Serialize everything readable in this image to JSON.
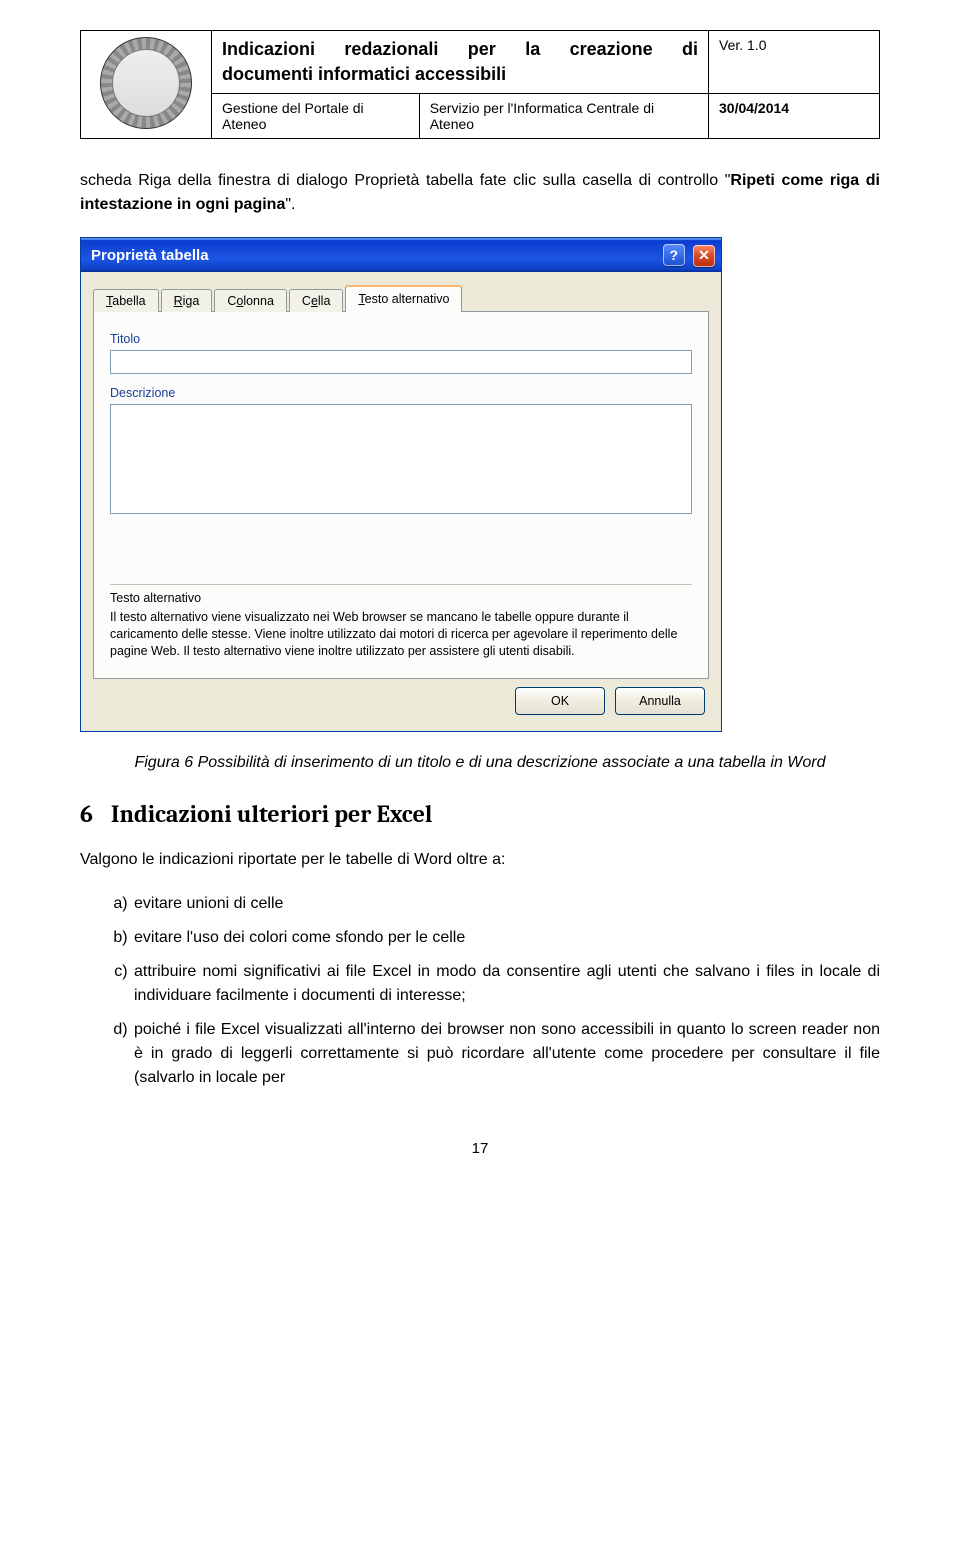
{
  "header": {
    "doc_title_line1": "Indicazioni redazionali per la creazione di",
    "doc_title_line2": "documenti informatici accessibili",
    "version": "Ver. 1.0",
    "dept": "Gestione del Portale di Ateneo",
    "service": "Servizio per l'Informatica Centrale di Ateneo",
    "date": "30/04/2014"
  },
  "intro_paragraph_part1": "scheda Riga della finestra di dialogo Proprietà tabella fate clic sulla casella di controllo \"",
  "intro_paragraph_bold": "Ripeti come riga di intestazione in ogni pagina",
  "intro_paragraph_part2": "\".",
  "dialog": {
    "title": "Proprietà tabella",
    "tabs": [
      "Tabella",
      "Riga",
      "Colonna",
      "Cella",
      "Testo alternativo"
    ],
    "tab_accesskey_idx": [
      0,
      0,
      1,
      1,
      0
    ],
    "active_tab": 4,
    "label_titolo": "Titolo",
    "label_descrizione": "Descrizione",
    "label_testo_alt": "Testo alternativo",
    "help_text": "Il testo alternativo viene visualizzato nei Web browser se mancano le tabelle oppure durante il caricamento delle stesse. Viene inoltre utilizzato dai motori di ricerca per agevolare il reperimento delle pagine Web. Il testo alternativo viene inoltre utilizzato per assistere gli utenti disabili.",
    "ok": "OK",
    "cancel": "Annulla"
  },
  "figure_caption": "Figura 6 Possibilità di inserimento di un titolo e di una descrizione associate a una tabella in Word",
  "section": {
    "num": "6",
    "title": "Indicazioni ulteriori per Excel"
  },
  "section_intro": "Valgono le indicazioni riportate per le tabelle di Word oltre a:",
  "list": [
    "evitare unioni di celle",
    "evitare l'uso dei colori come sfondo per le celle",
    "attribuire nomi significativi ai file Excel in modo da consentire agli utenti che salvano i files in locale di individuare facilmente i documenti di interesse;",
    "poiché i file Excel visualizzati all'interno dei browser non sono accessibili in quanto lo screen reader non è in grado di leggerli correttamente si può ricordare all'utente come procedere per consultare il file (salvarlo in locale per"
  ],
  "page_number": "17"
}
